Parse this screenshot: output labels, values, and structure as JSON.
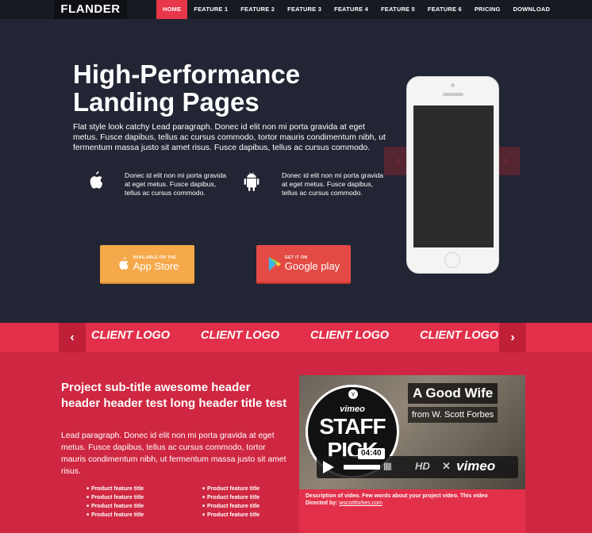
{
  "nav": {
    "brand": "FLANDER",
    "items": [
      {
        "label": "HOME",
        "active": true
      },
      {
        "label": "FEATURE 1"
      },
      {
        "label": "FEATURE 2"
      },
      {
        "label": "FEATURE 3"
      },
      {
        "label": "FEATURE 4"
      },
      {
        "label": "FEATURE 5"
      },
      {
        "label": "FEATURE 6"
      },
      {
        "label": "PRICING"
      },
      {
        "label": "DOWNLOAD"
      }
    ]
  },
  "hero": {
    "title_line1": "High-Performance",
    "title_line2": "Landing Pages",
    "lead": "Flat style look catchy Lead paragraph. Donec id elit non mi porta gravida at eget metus. Fusce dapibus, tellus ac cursus commodo, tortor mauris condimentum nibh, ut fermentum massa justo sit amet risus. Fusce dapibus, tellus ac cursus commodo.",
    "apple_icon": "apple-icon",
    "apple_text": "Donec id elit non mi porta gravida at eget metus. Fusce dapibus, tellus ac cursus commodo.",
    "android_icon": "android-icon",
    "android_text": "Donec id elit non mi porta gravida at eget metus. Fusce dapibus, tellus ac cursus commodo.",
    "appstore": {
      "small": "AVAILABLE ON THE",
      "big": "App Store"
    },
    "gplay": {
      "small": "GET IT ON",
      "big": "Google play"
    }
  },
  "clients": {
    "logos": [
      "CLIENT LOGO",
      "CLIENT LOGO",
      "CLIENT LOGO",
      "CLIENT LOGO"
    ],
    "prev": "‹",
    "next": "›"
  },
  "project": {
    "subtitle": "Project sub-title awesome header header header test long header title test",
    "lead": "Lead paragraph. Donec id elit non mi porta gravida at eget metus. Fusce dapibus, tellus ac cursus commodo, tortor mauris condimentum nibh, ut fermentum massa justo sit amet risus.",
    "features_left": [
      "Product feature title",
      "Product feature title",
      "Product feature title",
      "Product feature title"
    ],
    "features_right": [
      "Product feature title",
      "Product feature title",
      "Product feature title",
      "Product feature title"
    ]
  },
  "video": {
    "title": "A Good Wife",
    "from_prefix": "from",
    "author": "W. Scott Forbes",
    "badge_brand": "vimeo",
    "badge_line1": "STAFF",
    "badge_line2": "PICK",
    "time": "04:40",
    "hd": "HD",
    "brand": "vimeo",
    "caption": "Description of video. Few words about your project video. This video",
    "directed_by": "Directed by:",
    "director_link": "wscottforbes.com"
  },
  "colors": {
    "accent": "#e8364a",
    "hero_bg": "#222533",
    "content_bg": "#cf2741",
    "appstore": "#f5a94b",
    "gplay": "#e34a44"
  }
}
